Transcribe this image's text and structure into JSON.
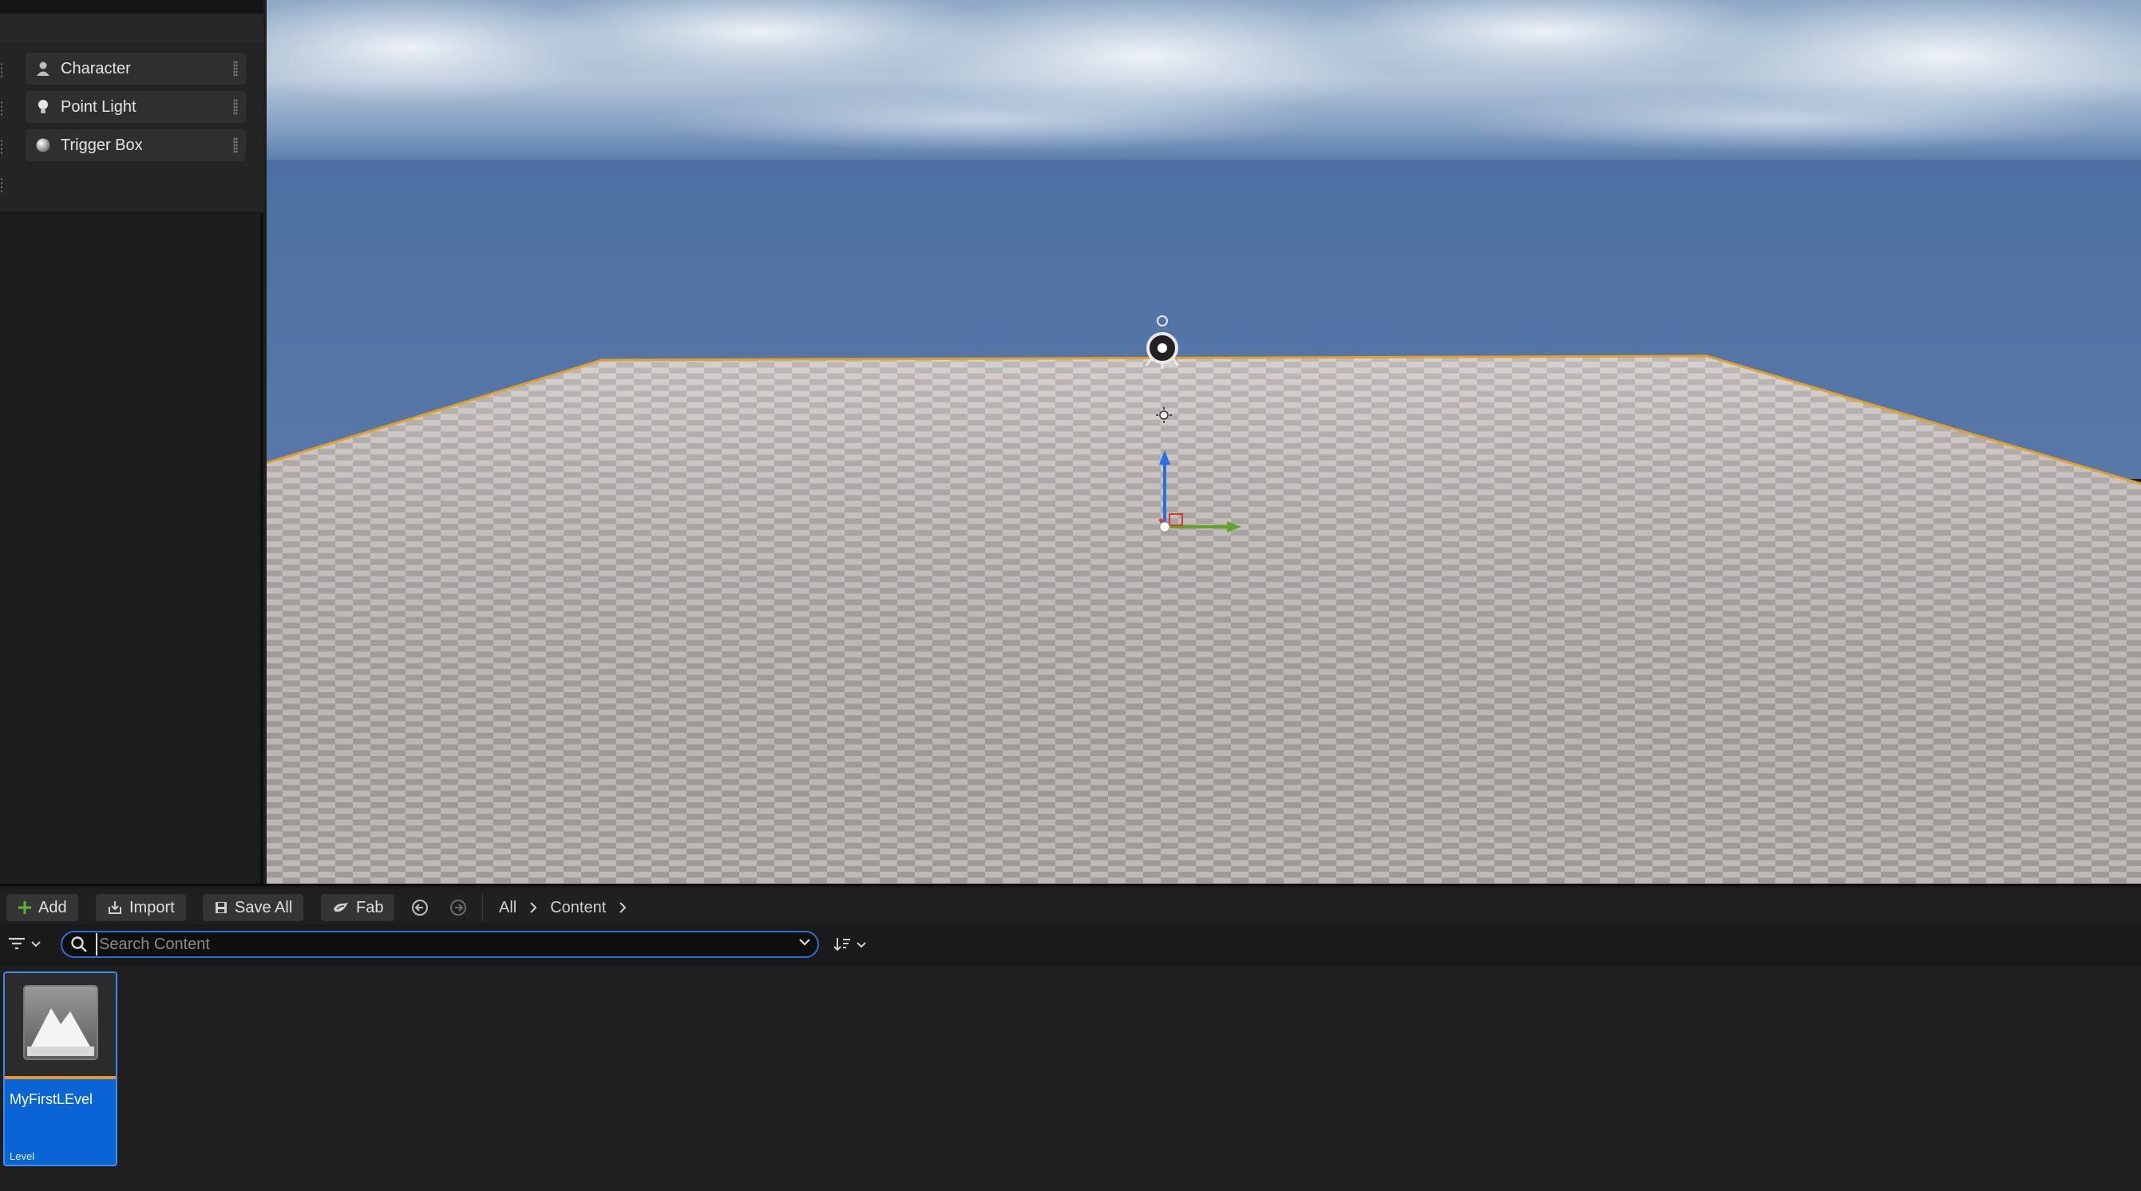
{
  "place_actors": {
    "items": [
      {
        "label": "Character",
        "icon": "character-icon"
      },
      {
        "label": "Point Light",
        "icon": "lightbulb-icon"
      },
      {
        "label": "Trigger Box",
        "icon": "sphere-icon"
      }
    ]
  },
  "content_browser": {
    "toolbar": {
      "add_label": "Add",
      "import_label": "Import",
      "save_all_label": "Save All",
      "fab_label": "Fab"
    },
    "breadcrumb": [
      "All",
      "Content"
    ],
    "search": {
      "placeholder": "Search Content",
      "value": ""
    },
    "assets": [
      {
        "name": "MyFirstLEvel",
        "type": "Level"
      }
    ]
  },
  "colors": {
    "accent_blue": "#0a64d6",
    "selection_orange": "#e8962a",
    "sky": "#4b6fa3"
  }
}
